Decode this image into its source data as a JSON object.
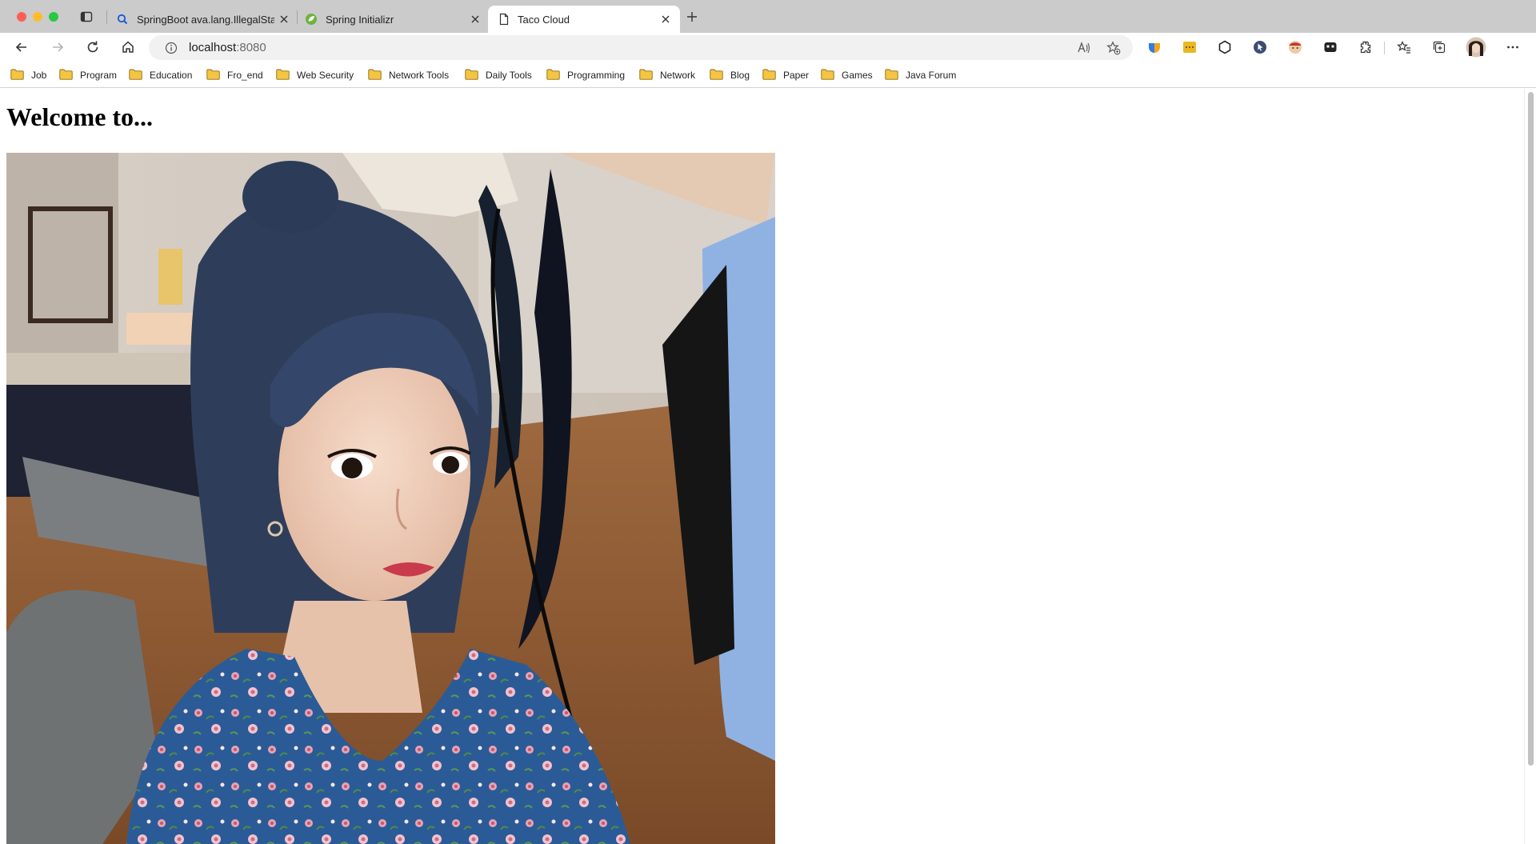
{
  "browser": {
    "tabs": [
      {
        "title": "SpringBoot ava.lang.IllegalSta",
        "favicon": "search-icon"
      },
      {
        "title": "Spring Initializr",
        "favicon": "spring-leaf-icon"
      },
      {
        "title": "Taco Cloud",
        "favicon": "page-icon",
        "active": true
      }
    ],
    "address": {
      "host": "localhost",
      "port": ":8080"
    },
    "bookmarks": [
      "Job",
      "Program",
      "Education",
      "Fro_end",
      "Web Security",
      "Network Tools",
      "Daily Tools",
      "Programming",
      "Network",
      "Blog",
      "Paper",
      "Games",
      "Java Forum"
    ],
    "colors": {
      "tabstrip": "#cbcbcb",
      "folder": "#f5c542",
      "close": "#ff5f57",
      "minimize": "#febc2e",
      "maximize": "#28c840"
    }
  },
  "page": {
    "heading": "Welcome to..."
  }
}
